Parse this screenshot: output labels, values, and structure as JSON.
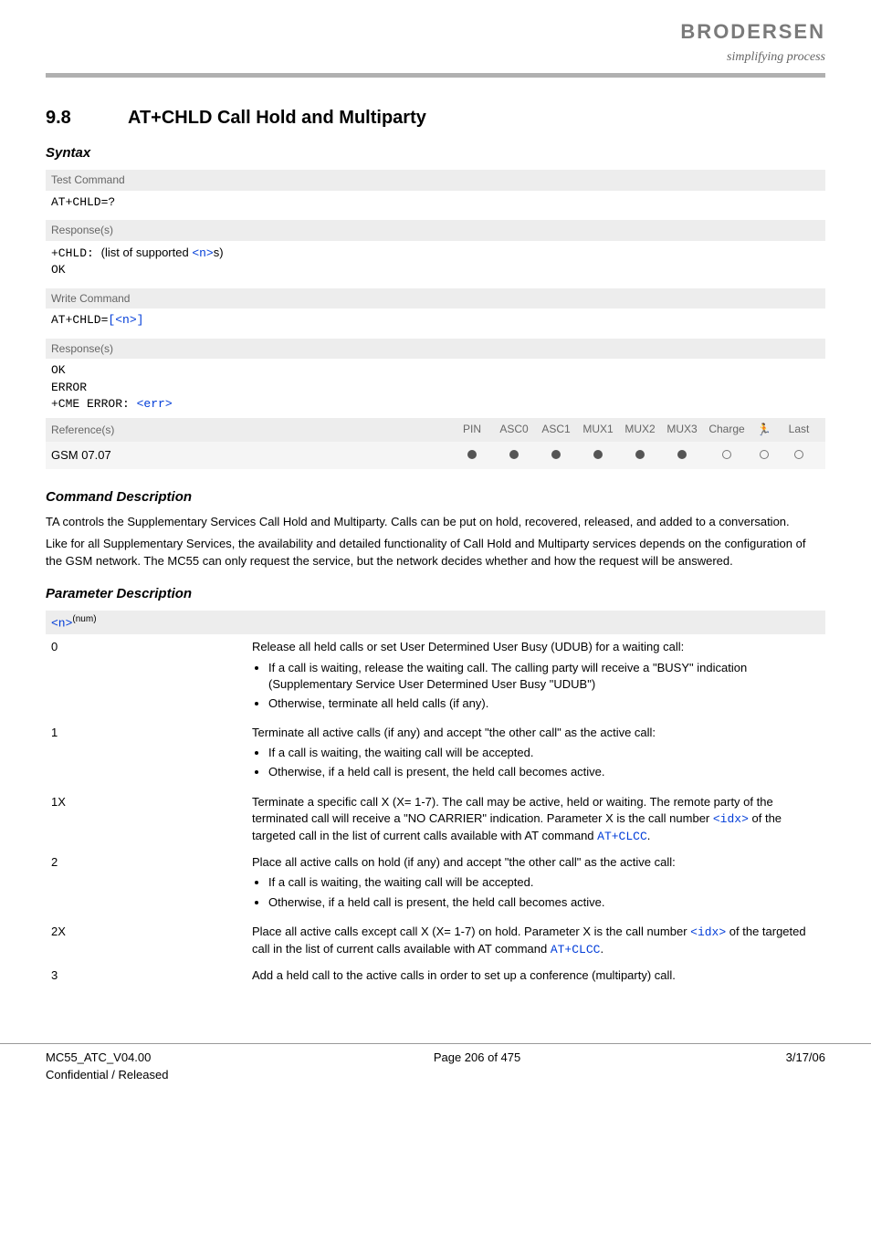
{
  "brand": {
    "logo": "BRODERSEN",
    "tagline": "simplifying process"
  },
  "section": {
    "number": "9.8",
    "title": "AT+CHLD   Call Hold and Multiparty"
  },
  "syntax_heading": "Syntax",
  "syntax": {
    "test_label": "Test Command",
    "test_cmd": "AT+CHLD=?",
    "resp_label": "Response(s)",
    "test_resp_prefix": "+CHLD: ",
    "test_resp_mid": "(list of supported ",
    "test_resp_var": "<n>",
    "test_resp_suffix": "s)",
    "ok": "OK",
    "write_label": "Write Command",
    "write_cmd_prefix": "AT+CHLD=",
    "write_cmd_br_open": "[",
    "write_cmd_var": "<n>",
    "write_cmd_br_close": "]",
    "err1": "ERROR",
    "err2_pre": "+CME ERROR: ",
    "err2_var": "<err>"
  },
  "ref": {
    "label": "Reference(s)",
    "cols": [
      "PIN",
      "ASC0",
      "ASC1",
      "MUX1",
      "MUX2",
      "MUX3",
      "Charge"
    ],
    "last": "Last",
    "gsm": "GSM 07.07"
  },
  "cmd_desc_heading": "Command Description",
  "cmd_desc_p1": "TA controls the Supplementary Services Call Hold and Multiparty. Calls can be put on hold, recovered, released, and added to a conversation.",
  "cmd_desc_p2": "Like for all Supplementary Services, the availability and detailed functionality of Call Hold and Multiparty services depends on the configuration of the GSM network. The MC55 can only request the service, but the network decides whether and how the request will be answered.",
  "param_heading": "Parameter Description",
  "param_var": "<n>",
  "param_sup": "(num)",
  "chart_data": {
    "type": "table",
    "columns": [
      "value",
      "description"
    ],
    "rows": [
      {
        "value": "0",
        "text": "Release all held calls or set User Determined User Busy (UDUB) for a waiting call:",
        "bullets": [
          "If a call is waiting, release the waiting call. The calling party will receive a \"BUSY\" indication (Supplementary Service User Determined User Busy \"UDUB\")",
          "Otherwise, terminate all held calls (if any)."
        ]
      },
      {
        "value": "1",
        "text": "Terminate all active calls (if any) and accept \"the other call\" as the active call:",
        "bullets": [
          "If a call is waiting, the waiting call will be accepted.",
          "Otherwise, if a held call is present, the held call becomes active."
        ]
      },
      {
        "value": "1X",
        "text_parts": [
          "Terminate a specific call X (X= 1-7). The call may be active, held or waiting. The remote party of the terminated call will receive a \"NO CARRIER\" indication. Parameter X is the call number ",
          " of the targeted call in the list of current calls available with AT command "
        ],
        "idx": "<idx>",
        "cmd": "AT+CLCC",
        "tail": "."
      },
      {
        "value": "2",
        "text": "Place all active calls on hold (if any) and accept \"the other call\" as the active call:",
        "bullets": [
          "If a call is waiting, the waiting call will be accepted.",
          "Otherwise, if a held call is present, the held call becomes active."
        ]
      },
      {
        "value": "2X",
        "text_parts": [
          "Place all active calls except call X (X= 1-7) on hold. Parameter X is the call number ",
          " of the targeted call in the list of current calls available with AT command "
        ],
        "idx": "<idx>",
        "cmd": "AT+CLCC",
        "tail": "."
      },
      {
        "value": "3",
        "text": "Add a held call to the active calls in order to set up a conference (multiparty) call."
      }
    ]
  },
  "footer": {
    "left1": "MC55_ATC_V04.00",
    "left2": "Confidential / Released",
    "center": "Page 206 of 475",
    "right": "3/17/06"
  }
}
